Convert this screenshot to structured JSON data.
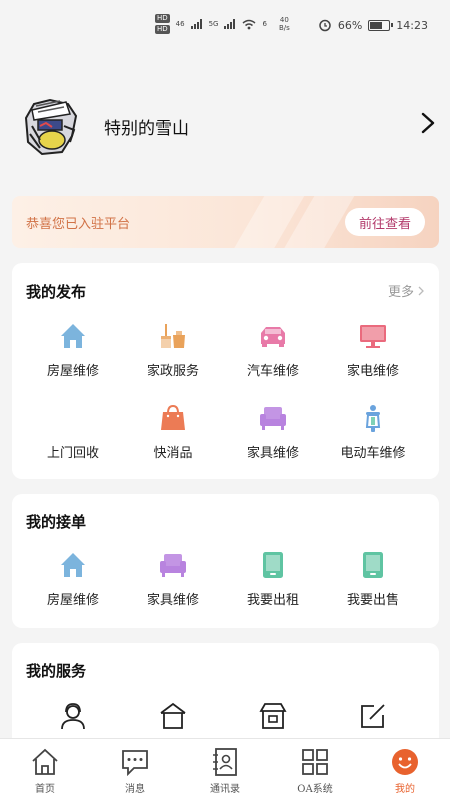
{
  "status_bar": {
    "hd1": "HD",
    "hd2": "HD",
    "net1": "46",
    "net2": "5G",
    "net3": "6",
    "speed": "40",
    "speed_unit": "B/s",
    "battery": "66%",
    "battery_level": 0.66,
    "time": "14:23"
  },
  "profile": {
    "username": "特别的雪山"
  },
  "banner": {
    "text": "恭喜您已入驻平台",
    "button": "前往查看"
  },
  "my_publish": {
    "title": "我的发布",
    "more": "更多",
    "items": [
      {
        "label": "房屋维修",
        "icon": "house-icon",
        "color": "#7cb4dd"
      },
      {
        "label": "家政服务",
        "icon": "broom-bucket-icon",
        "color": "#e9a25a"
      },
      {
        "label": "汽车维修",
        "icon": "car-icon",
        "color": "#e87aa8"
      },
      {
        "label": "家电维修",
        "icon": "tv-icon",
        "color": "#ea6a7d"
      },
      {
        "label": "上门回收",
        "icon": "blank-icon",
        "color": "#ffffff"
      },
      {
        "label": "快消品",
        "icon": "shopping-bag-icon",
        "color": "#ec7b55"
      },
      {
        "label": "家具维修",
        "icon": "sofa-icon",
        "color": "#b883df"
      },
      {
        "label": "电动车维修",
        "icon": "scooter-icon",
        "color": "#6aa3dd"
      }
    ]
  },
  "my_orders": {
    "title": "我的接单",
    "items": [
      {
        "label": "房屋维修",
        "icon": "house-icon",
        "color": "#7cb4dd"
      },
      {
        "label": "家具维修",
        "icon": "sofa-icon",
        "color": "#b883df"
      },
      {
        "label": "我要出租",
        "icon": "tablet-icon",
        "color": "#5fc4a2"
      },
      {
        "label": "我要出售",
        "icon": "tablet-icon",
        "color": "#5fc4a2"
      }
    ]
  },
  "my_services": {
    "title": "我的服务",
    "items": [
      {
        "icon": "customer-service-icon"
      },
      {
        "icon": "store-icon"
      },
      {
        "icon": "shop-icon"
      },
      {
        "icon": "edit-icon"
      }
    ]
  },
  "tabbar": {
    "active_color": "#e8622e",
    "tabs": [
      {
        "label": "首页",
        "icon": "home-icon"
      },
      {
        "label": "消息",
        "icon": "message-icon"
      },
      {
        "label": "通讯录",
        "icon": "contacts-icon"
      },
      {
        "label": "OA系统",
        "icon": "grid-icon"
      },
      {
        "label": "我的",
        "icon": "profile-icon"
      }
    ]
  }
}
